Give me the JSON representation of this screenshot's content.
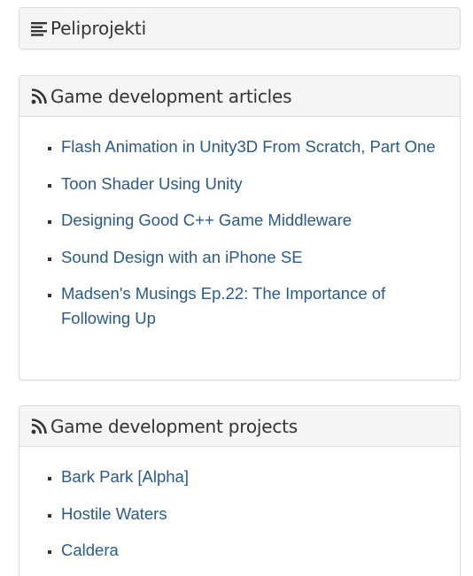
{
  "colors": {
    "link": "#2a5a8a",
    "panel_heading_bg": "#f5f5f5",
    "panel_border": "#dddddd",
    "text": "#333333"
  },
  "peliprojekti": {
    "icon": "menu-lines-icon",
    "title": "Peliprojekti"
  },
  "articles": {
    "icon": "rss-icon",
    "title": "Game development articles",
    "items": [
      "Flash Animation in Unity3D From Scratch, Part One",
      "Toon Shader Using Unity",
      "Designing Good C++ Game Middleware",
      "Sound Design with an iPhone SE",
      "Madsen's Musings Ep.22: The Importance of Following Up"
    ]
  },
  "projects": {
    "icon": "rss-icon",
    "title": "Game development projects",
    "items": [
      "Bark Park [Alpha]",
      "Hostile Waters",
      "Caldera"
    ]
  }
}
